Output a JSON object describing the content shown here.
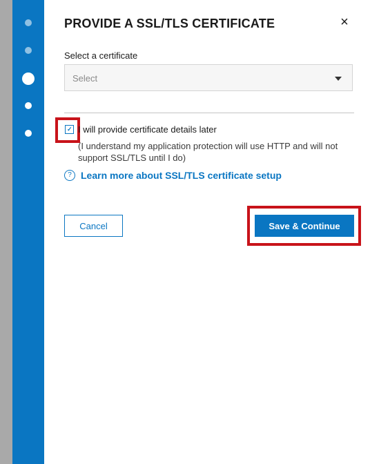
{
  "dialog": {
    "title": "PROVIDE A SSL/TLS CERTIFICATE",
    "close_label": "×"
  },
  "certificate_select": {
    "label": "Select a certificate",
    "selected_value": "Select"
  },
  "defer_option": {
    "checked": true,
    "check_mark": "✓",
    "label": "I will provide certificate details later",
    "note": "(I understand my application protection will use HTTP and will not support SSL/TLS until I do)"
  },
  "help": {
    "icon_glyph": "?",
    "link_text": "Learn more about SSL/TLS certificate setup"
  },
  "actions": {
    "cancel_label": "Cancel",
    "save_label": "Save & Continue"
  },
  "stepper": {
    "current_step": 3,
    "total_steps": 5
  },
  "colors": {
    "accent": "#0a76c2",
    "highlight": "#c8131a"
  },
  "icons": [
    "close-icon",
    "chevron-down-icon",
    "check-icon",
    "help-icon"
  ]
}
